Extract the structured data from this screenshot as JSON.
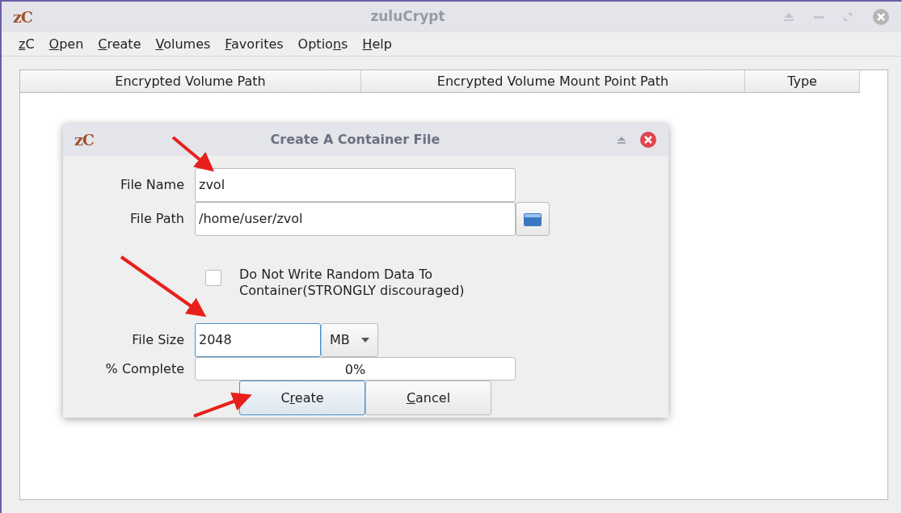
{
  "window": {
    "logo": "zC",
    "title": "zuluCrypt"
  },
  "menu": [
    {
      "key": "z",
      "post": "C"
    },
    {
      "key": "O",
      "post": "pen"
    },
    {
      "key": "C",
      "post": "reate"
    },
    {
      "key": "V",
      "post": "olumes"
    },
    {
      "key": "F",
      "post": "avorites"
    },
    {
      "pre": "Optio",
      "key": "n",
      "post": "s"
    },
    {
      "key": "H",
      "post": "elp"
    }
  ],
  "table": {
    "columns": [
      "Encrypted Volume Path",
      "Encrypted Volume Mount Point Path",
      "Type"
    ]
  },
  "dialog": {
    "logo": "zC",
    "title": "Create A Container File",
    "file_name": {
      "label": "File Name",
      "value": "zvol"
    },
    "file_path": {
      "label": "File Path",
      "value": "/home/user/zvol"
    },
    "random_data": {
      "label": "Do Not Write Random Data To Container(STRONGLY discouraged)",
      "checked": false
    },
    "file_size": {
      "label": "File Size",
      "value": "2048",
      "unit": "MB"
    },
    "progress": {
      "label": "% Complete",
      "level": 0,
      "reading": "0%"
    },
    "buttons": [
      {
        "pre": "C",
        "key": "r",
        "post": "eate",
        "focused": true
      },
      {
        "key": "C",
        "post": "ancel",
        "focused": false
      }
    ]
  }
}
